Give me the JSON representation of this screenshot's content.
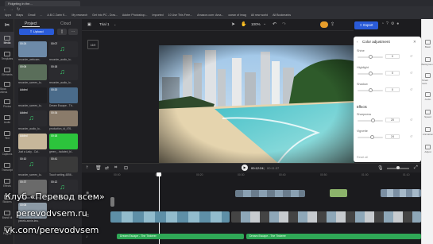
{
  "browser": {
    "tab_title": "Fidgeting in the...",
    "url": "capcut.com/editor/0E2F4E6-5898-4123-98B8-17E884A83F7E?__action_from=my_draft&workspaceId=7239XXXXXX&spaceId=7239",
    "bookmarks": [
      "Apps",
      "Maps",
      "Gmail",
      "...",
      "A.B.C Zarin K...",
      "My research",
      "Get into PC - Dow...",
      "Adobe Photoshop...",
      "Imported",
      "10 Use This Free...",
      "Amazon.com: Ama...",
      "ocean of imag",
      "All new world",
      "All Bookmarks"
    ]
  },
  "left_rail": [
    "Media",
    "Templates",
    "Elements",
    "Stock videos",
    "Photos",
    "Audio",
    "Text",
    "Captions",
    "Transcript",
    "Effects",
    "Stickers",
    "Brand kit",
    "Plugins"
  ],
  "media_panel": {
    "tab_project": "Project",
    "tab_cloud": "Cloud",
    "upload_label": "Upload",
    "items": [
      {
        "caption": "recorder_webcam..",
        "duration": "00:24"
      },
      {
        "caption": "recorder_audio_lo..",
        "duration": "00:07"
      },
      {
        "caption": "recorder_screen_lo..",
        "duration": "00:06"
      },
      {
        "caption": "recorder_audio_lo..",
        "duration": "00:18"
      },
      {
        "caption": "recorder_screen_lo..",
        "duration": "Added"
      },
      {
        "caption": "Dream Escape - Th..",
        "duration": "00:20"
      },
      {
        "caption": "recorder_audio_lo..",
        "duration": "Added"
      },
      {
        "caption": "production_id_476..",
        "duration": "00:34"
      },
      {
        "caption": "Just a Lady - Cal..",
        "duration": "Added"
      },
      {
        "caption": "green_..isolated_bl..",
        "duration": "00:18"
      },
      {
        "caption": "recorder_screen_lo..",
        "duration": "00:10"
      },
      {
        "caption": "Touch writing-4856..",
        "duration": "00:41"
      },
      {
        "caption": "Stepdown to-Comp..",
        "duration": "00:37"
      },
      {
        "caption": "recorder_audio_lo..",
        "duration": "00:12"
      },
      {
        "caption": "pexels-annie-lew..",
        "duration": "00:06"
      }
    ]
  },
  "canvas_toolbar": {
    "project_name": "Trial 1",
    "zoom": "100%",
    "export_label": "Export",
    "ratio_label": "16:9"
  },
  "color_panel": {
    "title": "Color adjustment",
    "rows": [
      {
        "label": "Shine",
        "value": "0",
        "level": 0.5
      },
      {
        "label": "Highlight",
        "value": "0",
        "level": 0.5
      },
      {
        "label": "Shadow",
        "value": "0",
        "level": 0.5
      }
    ],
    "effects_title": "Effects",
    "effect_rows": [
      {
        "label": "Sharpness",
        "value": "20",
        "level": 0.6
      },
      {
        "label": "Vignette",
        "value": "24",
        "level": 0.55
      }
    ],
    "reset_label": "Reset all"
  },
  "right_rail": [
    "Basic",
    "Background",
    "Smart tools",
    "Audio",
    "Speed",
    "Animation",
    "Adjust"
  ],
  "timeline": {
    "current_time": "00:12:24",
    "total_time": "00:11:37",
    "ruler": [
      "00:00",
      "00:10",
      "00:20",
      "00:30",
      "00:40",
      "00:50",
      "01:00",
      "01:10"
    ],
    "audio_clips": [
      "Dream Escape - The Tinkerer",
      "Dream Escape - The Tinkerer"
    ]
  },
  "watermark": {
    "line1": "Клуб «Перевод всем»",
    "line2": "perevodvsem.ru",
    "line3": "vk.com/perevodvsem"
  }
}
